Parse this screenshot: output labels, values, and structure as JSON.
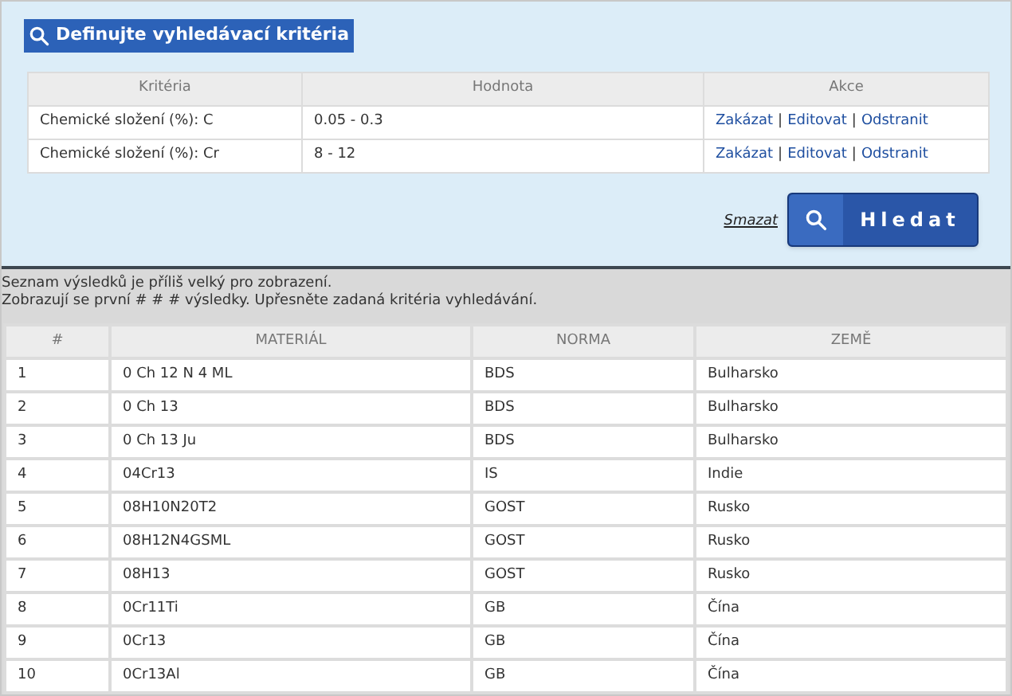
{
  "criteria_panel": {
    "title": "Definujte vyhledávací kritéria",
    "table": {
      "columns": [
        "Kritéria",
        "Hodnota",
        "Akce"
      ],
      "rows": [
        {
          "criterion": "Chemické složení (%): C",
          "value": "0.05 - 0.3",
          "actions": [
            {
              "kind": "link",
              "text": "Zakázat"
            },
            {
              "kind": "separator",
              "text": "|"
            },
            {
              "kind": "link",
              "text": "Editovat"
            },
            {
              "kind": "separator",
              "text": "|"
            },
            {
              "kind": "link",
              "text": "Odstranit"
            }
          ]
        },
        {
          "criterion": "Chemické složení (%): Cr",
          "value": "8 - 12",
          "actions": [
            {
              "kind": "link",
              "text": "Zakázat"
            },
            {
              "kind": "separator",
              "text": "|"
            },
            {
              "kind": "link",
              "text": "Editovat"
            },
            {
              "kind": "separator",
              "text": "|"
            },
            {
              "kind": "link",
              "text": "Odstranit"
            }
          ]
        }
      ]
    },
    "clear_link": "Smazat",
    "search_button": "Hledat"
  },
  "message": [
    "Seznam výsledků je příliš velký pro zobrazení.",
    "Zobrazují se první # # # výsledky. Upřesněte zadaná kritéria vyhledávání."
  ],
  "results": {
    "columns": [
      "#",
      "MATERIÁL",
      "NORMA",
      "ZEMĚ"
    ],
    "rows": [
      [
        "1",
        "0 Ch 12 N 4 ML",
        "BDS",
        "Bulharsko"
      ],
      [
        "2",
        "0 Ch 13",
        "BDS",
        "Bulharsko"
      ],
      [
        "3",
        "0 Ch 13 Ju",
        "BDS",
        "Bulharsko"
      ],
      [
        "4",
        "04Cr13",
        "IS",
        "Indie"
      ],
      [
        "5",
        "08H10N20T2",
        "GOST",
        "Rusko"
      ],
      [
        "6",
        "08H12N4GSML",
        "GOST",
        "Rusko"
      ],
      [
        "7",
        "08H13",
        "GOST",
        "Rusko"
      ],
      [
        "8",
        "0Cr11Ti",
        "GB",
        "Čína"
      ],
      [
        "9",
        "0Cr13",
        "GB",
        "Čína"
      ],
      [
        "10",
        "0Cr13Al",
        "GB",
        "Čína"
      ]
    ]
  }
}
